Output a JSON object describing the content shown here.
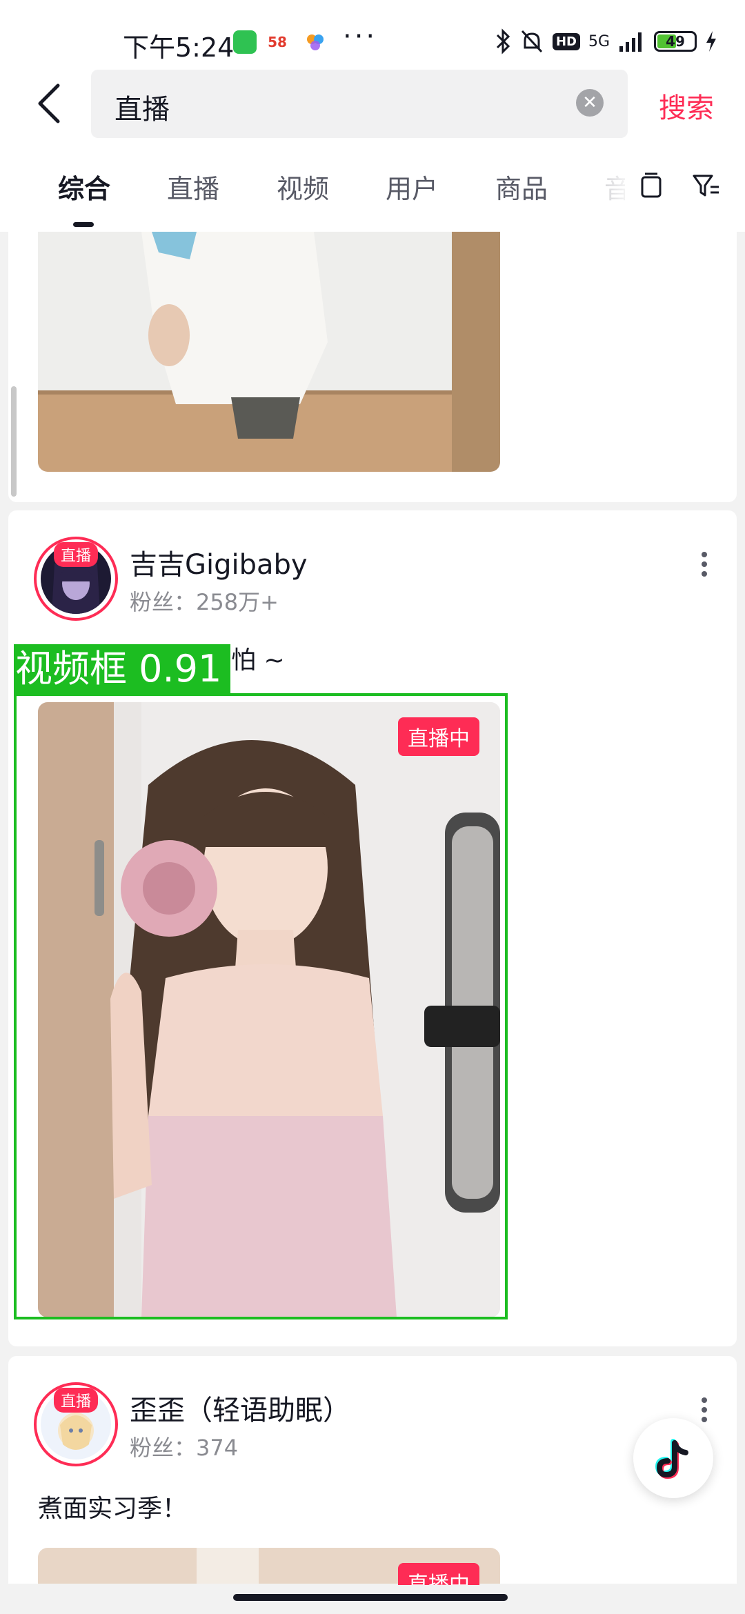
{
  "status_bar": {
    "time": "下午5:24",
    "app_58_label": "58",
    "network": "5G",
    "hd_label": "HD",
    "battery": "49"
  },
  "header": {
    "query": "直播",
    "search_label": "搜索"
  },
  "tabs": [
    "综合",
    "直播",
    "视频",
    "用户",
    "商品",
    "音"
  ],
  "posts": [
    {
      "live_badge": "直播",
      "name": "吉吉Gigibaby",
      "fans": "粉丝：258万+",
      "caption": "怕 ~",
      "live_tag": "直播中"
    },
    {
      "live_badge": "直播",
      "name": "歪歪（轻语助眠）",
      "fans": "粉丝：374",
      "caption": "煮面实习季！",
      "live_tag": "直播中"
    }
  ],
  "detection": {
    "label": "视频框 0.91",
    "color": "#1cbd21"
  },
  "colors": {
    "accent": "#fe2c55",
    "text": "#161823",
    "secondary": "#8a8b91"
  },
  "icons": [
    "back-icon",
    "clear-icon",
    "window-icon",
    "filter-icon",
    "more-icon",
    "tiktok-icon"
  ]
}
